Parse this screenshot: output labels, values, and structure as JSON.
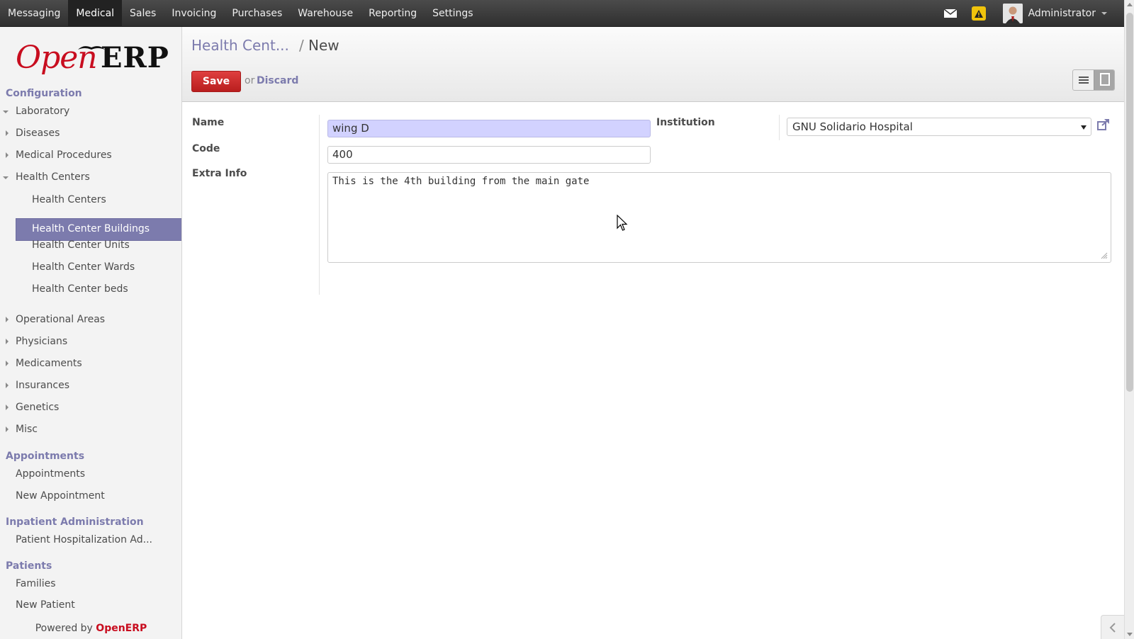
{
  "topbar": {
    "menu": [
      "Messaging",
      "Medical",
      "Sales",
      "Invoicing",
      "Purchases",
      "Warehouse",
      "Reporting",
      "Settings"
    ],
    "active_menu": "Medical",
    "user_name": "Administrator"
  },
  "sidebar": {
    "logo_open": "Open",
    "logo_erp": "ERP",
    "sections": [
      {
        "title": "Configuration"
      },
      {
        "title": "Appointments"
      },
      {
        "title": "Inpatient Administration"
      },
      {
        "title": "Patients"
      }
    ],
    "config_items": [
      "Laboratory",
      "Diseases",
      "Medical Procedures",
      "Health Centers"
    ],
    "health_center_subitems": [
      "Health Centers",
      "Health Center Buildings",
      "Health Center Units",
      "Health Center Wards",
      "Health Center beds"
    ],
    "selected_item": "Health Center Buildings",
    "more_config_items": [
      "Operational Areas",
      "Physicians",
      "Medicaments",
      "Insurances",
      "Genetics",
      "Misc"
    ],
    "appointment_items": [
      "Appointments",
      "New Appointment"
    ],
    "inpatient_items": [
      "Patient Hospitalization Ad..."
    ],
    "patient_items": [
      "Families",
      "New Patient"
    ],
    "powered_prefix": "Powered by",
    "powered_brand": "OpenERP"
  },
  "main": {
    "breadcrumb_parent": "Health Cent...",
    "breadcrumb_sep": "/",
    "breadcrumb_current": "New",
    "save_label": "Save",
    "or_label": "or",
    "discard_label": "Discard"
  },
  "form": {
    "name_label": "Name",
    "name_value": "wing D",
    "code_label": "Code",
    "code_value": "400",
    "extra_info_label": "Extra Info",
    "extra_info_value": "This is the 4th building from the main gate",
    "institution_label": "Institution",
    "institution_value": "GNU Solidario Hospital"
  },
  "colors": {
    "accent": "#7c7bad",
    "brand_red": "#c80d1f",
    "save_button": "#c42b2b",
    "required_field": "#d2d2ff"
  }
}
